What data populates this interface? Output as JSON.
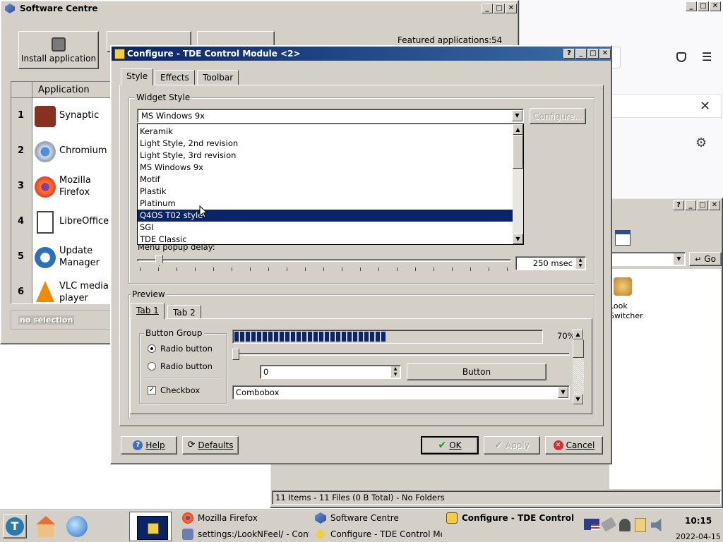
{
  "software_centre": {
    "title": "Software Centre",
    "toolbar": {
      "install_label": "Install application"
    },
    "featured_label": "Featured applications:",
    "featured_count": "54",
    "column_header": "Application",
    "apps": [
      {
        "rank": "1",
        "name": "Synaptic"
      },
      {
        "rank": "2",
        "name": "Chromium"
      },
      {
        "rank": "3",
        "name": "Mozilla Firefox"
      },
      {
        "rank": "4",
        "name": "LibreOffice"
      },
      {
        "rank": "5",
        "name": "Update Manager"
      },
      {
        "rank": "6",
        "name": "VLC media player"
      }
    ],
    "status": "no selection"
  },
  "file_manager": {
    "go_label": "Go",
    "icon_label": "Look Switcher",
    "status": "11 Items - 11 Files (0 B Total) - No Folders"
  },
  "dialog": {
    "title": "Configure - TDE Control Module <2>",
    "tabs": [
      "Style",
      "Effects",
      "Toolbar"
    ],
    "widget_style": {
      "group_label": "Widget Style",
      "current": "MS Windows 9x",
      "configure_label": "Configure...",
      "options": [
        "Keramik",
        "Light Style, 2nd revision",
        "Light Style, 3rd revision",
        "MS Windows 9x",
        "Motif",
        "Plastik",
        "Platinum",
        "Q4OS T02 style",
        "SGI",
        "TDE Classic"
      ],
      "selected_index": 7
    },
    "menu_delay_label": "Menu popup delay:",
    "menu_delay_value": "250 msec",
    "menu_delay_fraction": 0.05,
    "preview": {
      "group_label": "Preview",
      "tabs": [
        "Tab 1",
        "Tab 2"
      ],
      "button_group_label": "Button Group",
      "radio1": "Radio button",
      "radio2": "Radio button",
      "checkbox": "Checkbox",
      "progress_percent": 70,
      "progress_label": "70%",
      "spin_value": "0",
      "button_label": "Button",
      "combobox_value": "Combobox"
    },
    "buttons": {
      "help": "Help",
      "defaults": "Defaults",
      "ok": "OK",
      "apply": "Apply",
      "cancel": "Cancel"
    }
  },
  "taskbar": {
    "tasks": [
      {
        "label": "Mozilla Firefox"
      },
      {
        "label": "Software Centre"
      },
      {
        "label": "Configure - TDE Control I"
      },
      {
        "label": "settings:/LookNFeel/ - Contr"
      },
      {
        "label": "Configure - TDE Control Mo"
      }
    ],
    "time": "10:15",
    "date": "2022-04-15"
  }
}
